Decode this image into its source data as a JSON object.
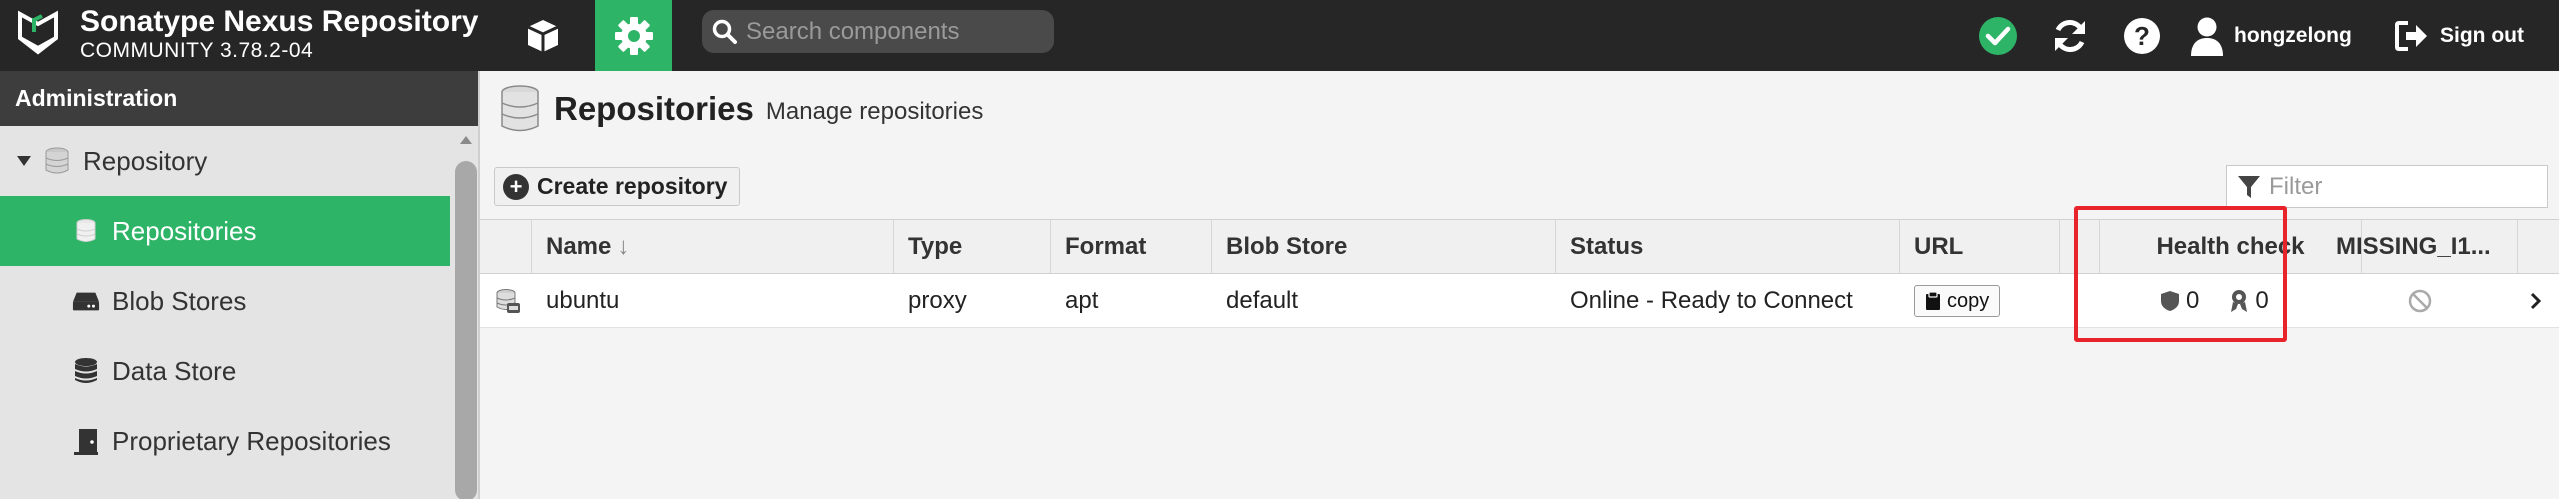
{
  "app": {
    "title": "Sonatype Nexus Repository",
    "edition": "COMMUNITY 3.78.2-04"
  },
  "topbar": {
    "search_placeholder": "Search components",
    "username": "hongzelong",
    "signout_label": "Sign out",
    "icons": [
      "nexus-logo-icon",
      "cube-icon",
      "gear-icon",
      "search-icon",
      "check-circle-icon",
      "refresh-icon",
      "help-icon",
      "user-icon",
      "sign-out-icon"
    ],
    "accent_color": "#2eb467"
  },
  "sidebar": {
    "header": "Administration",
    "items": [
      {
        "label": "Repository",
        "icon": "database-icon",
        "type": "group"
      },
      {
        "label": "Repositories",
        "icon": "database-icon",
        "type": "child",
        "active": true
      },
      {
        "label": "Blob Stores",
        "icon": "hard-drive-icon",
        "type": "child"
      },
      {
        "label": "Data Store",
        "icon": "database-icon",
        "type": "child"
      },
      {
        "label": "Proprietary Repositories",
        "icon": "door-icon",
        "type": "child"
      }
    ]
  },
  "main": {
    "title": "Repositories",
    "subtitle": "Manage repositories",
    "create_button": "Create repository",
    "filter_placeholder": "Filter",
    "columns": [
      "Name",
      "Type",
      "Format",
      "Blob Store",
      "Status",
      "URL",
      "Health check",
      "MISSING_I1..."
    ],
    "sort_indicator": "↓",
    "rows": [
      {
        "name": "ubuntu",
        "type": "proxy",
        "format": "apt",
        "blob_store": "default",
        "status": "Online - Ready to Connect",
        "url_button": "copy",
        "health_security": "0",
        "health_license": "0"
      }
    ]
  }
}
